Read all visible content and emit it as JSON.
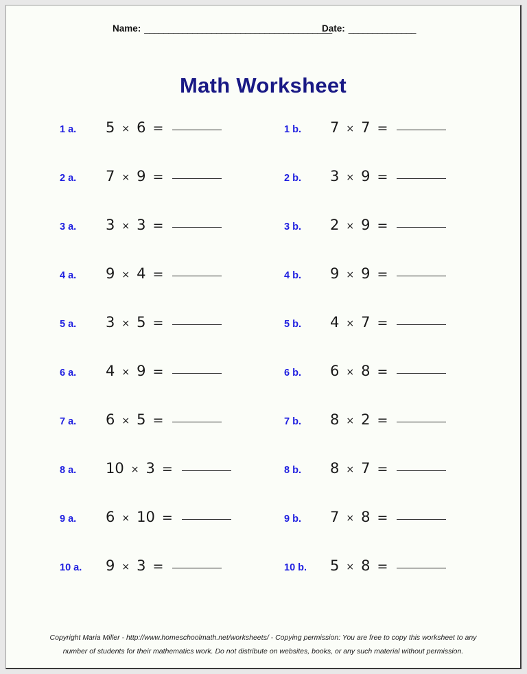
{
  "page": {
    "title": "Math Worksheet",
    "title_color": "#191985",
    "label_color": "#1f1fe0",
    "background": "#fbfdf8"
  },
  "header": {
    "name_label": "Name:",
    "name_blank": "_______________________________________",
    "date_label": "Date:",
    "date_blank": "______________"
  },
  "problems": {
    "answer_blank": "",
    "times_symbol": "×",
    "equals_symbol": "=",
    "rows": [
      {
        "a": {
          "label": "1 a.",
          "left": "5",
          "right": "6"
        },
        "b": {
          "label": "1 b.",
          "left": "7",
          "right": "7"
        }
      },
      {
        "a": {
          "label": "2 a.",
          "left": "7",
          "right": "9"
        },
        "b": {
          "label": "2 b.",
          "left": "3",
          "right": "9"
        }
      },
      {
        "a": {
          "label": "3 a.",
          "left": "3",
          "right": "3"
        },
        "b": {
          "label": "3 b.",
          "left": "2",
          "right": "9"
        }
      },
      {
        "a": {
          "label": "4 a.",
          "left": "9",
          "right": "4"
        },
        "b": {
          "label": "4 b.",
          "left": "9",
          "right": "9"
        }
      },
      {
        "a": {
          "label": "5 a.",
          "left": "3",
          "right": "5"
        },
        "b": {
          "label": "5 b.",
          "left": "4",
          "right": "7"
        }
      },
      {
        "a": {
          "label": "6 a.",
          "left": "4",
          "right": "9"
        },
        "b": {
          "label": "6 b.",
          "left": "6",
          "right": "8"
        }
      },
      {
        "a": {
          "label": "7 a.",
          "left": "6",
          "right": "5"
        },
        "b": {
          "label": "7 b.",
          "left": "8",
          "right": "2"
        }
      },
      {
        "a": {
          "label": "8 a.",
          "left": "10",
          "right": "3"
        },
        "b": {
          "label": "8 b.",
          "left": "8",
          "right": "7"
        }
      },
      {
        "a": {
          "label": "9 a.",
          "left": "6",
          "right": "10"
        },
        "b": {
          "label": "9 b.",
          "left": "7",
          "right": "8"
        }
      },
      {
        "a": {
          "label": "10 a.",
          "left": "9",
          "right": "3"
        },
        "b": {
          "label": "10 b.",
          "left": "5",
          "right": "8"
        }
      }
    ]
  },
  "footer": {
    "line1": "Copyright Maria Miller - http://www.homeschoolmath.net/worksheets/ - Copying permission: You are free to copy this worksheet to any",
    "line2": "number of students for their mathematics work. Do not distribute on websites, books, or any such material without permission."
  }
}
